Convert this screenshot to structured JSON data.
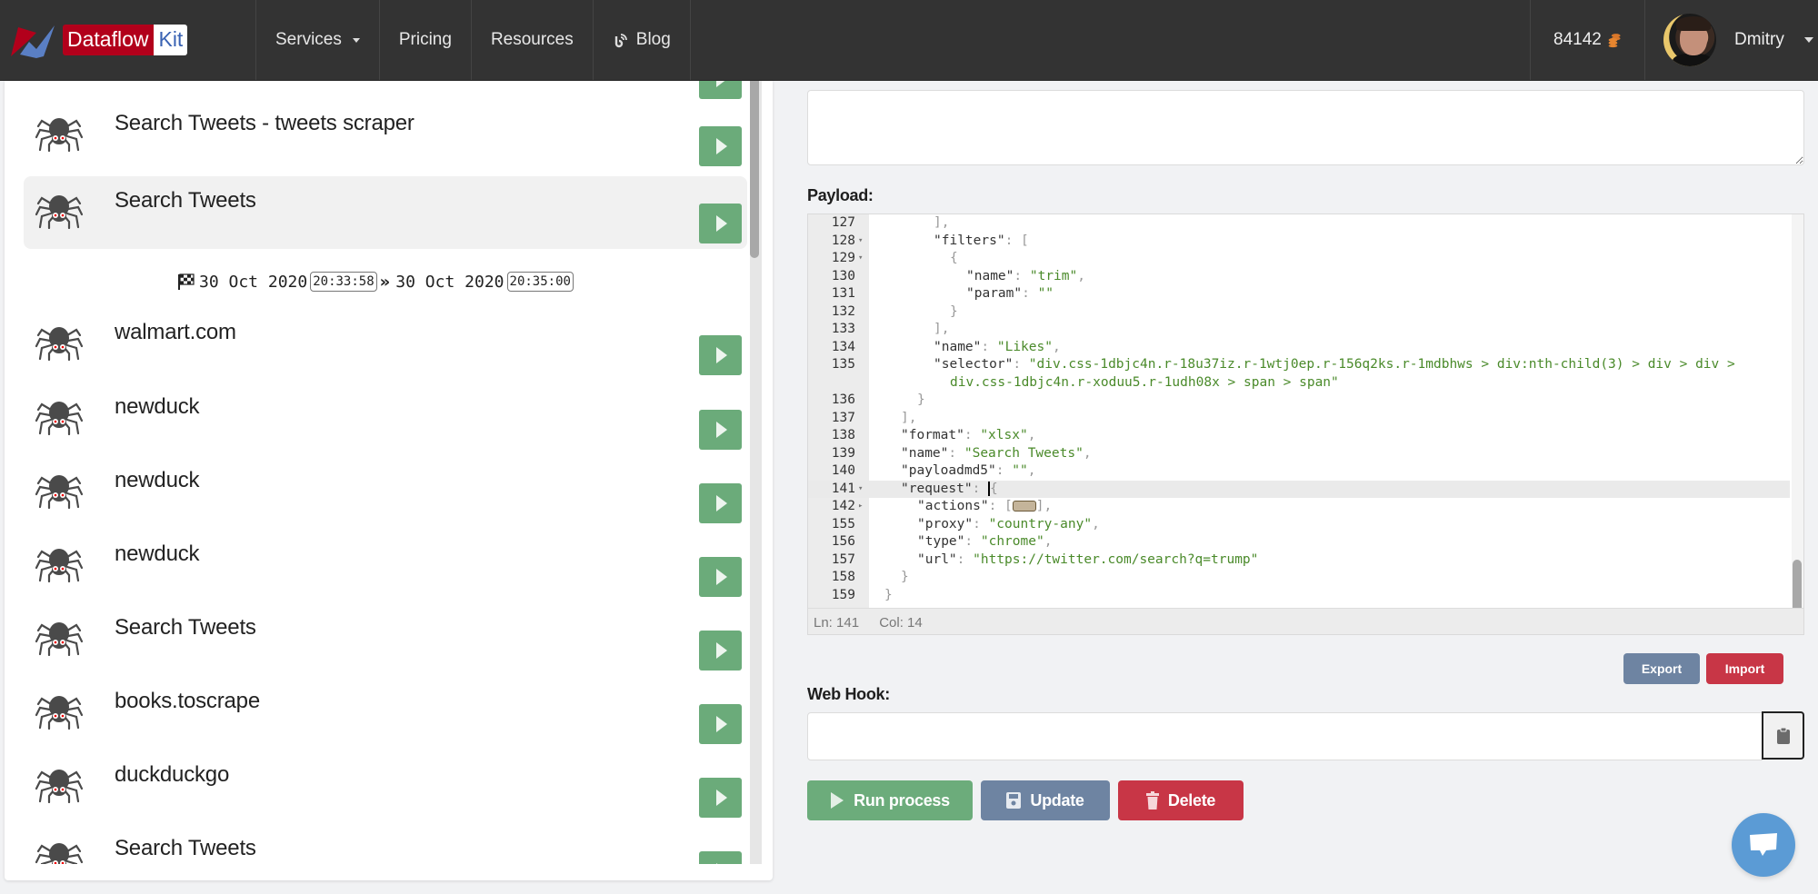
{
  "navbar": {
    "brand_part1": "Dataflow",
    "brand_part2": "Kit",
    "items": [
      {
        "label": "Services",
        "has_dropdown": true
      },
      {
        "label": "Pricing"
      },
      {
        "label": "Resources"
      },
      {
        "label": "Blog",
        "icon": "blog-rss-icon"
      }
    ],
    "credits": "84142",
    "credits_icon": "coins-icon",
    "user_name": "Dmitry"
  },
  "tasks": {
    "items": [
      {
        "title": "Search Tweets - tweets scraper",
        "active": false
      },
      {
        "title": "Search Tweets",
        "active": true
      },
      {
        "title": "walmart.com",
        "active": false
      },
      {
        "title": "newduck",
        "active": false
      },
      {
        "title": "newduck",
        "active": false
      },
      {
        "title": "newduck",
        "active": false
      },
      {
        "title": "Search Tweets",
        "active": false
      },
      {
        "title": "books.toscrape",
        "active": false
      },
      {
        "title": "duckduckgo",
        "active": false
      },
      {
        "title": "Search Tweets",
        "active": false
      }
    ],
    "active_run": {
      "start_date": "30 Oct 2020",
      "start_time": "20:33:58",
      "end_date": "30 Oct 2020",
      "end_time": "20:35:00"
    }
  },
  "form": {
    "payload_label": "Payload:",
    "webhook_label": "Web Hook:",
    "webhook_value": "",
    "editor": {
      "lines": [
        {
          "n": "127",
          "fold": "",
          "indent": 3,
          "tokens": [
            [
              "p",
              "],"
            ]
          ]
        },
        {
          "n": "128",
          "fold": "open",
          "indent": 3,
          "tokens": [
            [
              "k",
              "\"filters\""
            ],
            [
              "p",
              ": ["
            ]
          ]
        },
        {
          "n": "129",
          "fold": "open",
          "indent": 4,
          "tokens": [
            [
              "p",
              "{"
            ]
          ]
        },
        {
          "n": "130",
          "fold": "",
          "indent": 5,
          "tokens": [
            [
              "k",
              "\"name\""
            ],
            [
              "p",
              ": "
            ],
            [
              "s",
              "\"trim\""
            ],
            [
              "p",
              ","
            ]
          ]
        },
        {
          "n": "131",
          "fold": "",
          "indent": 5,
          "tokens": [
            [
              "k",
              "\"param\""
            ],
            [
              "p",
              ": "
            ],
            [
              "s",
              "\"\""
            ]
          ]
        },
        {
          "n": "132",
          "fold": "",
          "indent": 4,
          "tokens": [
            [
              "p",
              "}"
            ]
          ]
        },
        {
          "n": "133",
          "fold": "",
          "indent": 3,
          "tokens": [
            [
              "p",
              "],"
            ]
          ]
        },
        {
          "n": "134",
          "fold": "",
          "indent": 3,
          "tokens": [
            [
              "k",
              "\"name\""
            ],
            [
              "p",
              ": "
            ],
            [
              "s",
              "\"Likes\""
            ],
            [
              "p",
              ","
            ]
          ]
        },
        {
          "n": "135",
          "fold": "",
          "indent": 3,
          "tokens": [
            [
              "k",
              "\"selector\""
            ],
            [
              "p",
              ": "
            ],
            [
              "s",
              "\"div.css-1dbjc4n.r-18u37iz.r-1wtj0ep.r-156q2ks.r-1mdbhws > div:nth-child(3) > div > div >"
            ]
          ]
        },
        {
          "n": "",
          "fold": "",
          "indent": 4,
          "tokens": [
            [
              "s",
              "div.css-1dbjc4n.r-xoduu5.r-1udh08x > span > span\""
            ]
          ]
        },
        {
          "n": "136",
          "fold": "",
          "indent": 2,
          "tokens": [
            [
              "p",
              "}"
            ]
          ]
        },
        {
          "n": "137",
          "fold": "",
          "indent": 1,
          "tokens": [
            [
              "p",
              "],"
            ]
          ]
        },
        {
          "n": "138",
          "fold": "",
          "indent": 1,
          "tokens": [
            [
              "k",
              "\"format\""
            ],
            [
              "p",
              ": "
            ],
            [
              "s",
              "\"xlsx\""
            ],
            [
              "p",
              ","
            ]
          ]
        },
        {
          "n": "139",
          "fold": "",
          "indent": 1,
          "tokens": [
            [
              "k",
              "\"name\""
            ],
            [
              "p",
              ": "
            ],
            [
              "s",
              "\"Search Tweets\""
            ],
            [
              "p",
              ","
            ]
          ]
        },
        {
          "n": "140",
          "fold": "",
          "indent": 1,
          "tokens": [
            [
              "k",
              "\"payloadmd5\""
            ],
            [
              "p",
              ": "
            ],
            [
              "s",
              "\"\""
            ],
            [
              "p",
              ","
            ]
          ]
        },
        {
          "n": "141",
          "fold": "open",
          "indent": 1,
          "highlight": true,
          "tokens": [
            [
              "k",
              "\"request\""
            ],
            [
              "p",
              ": "
            ],
            [
              "cursor",
              ""
            ],
            [
              "p",
              "{"
            ]
          ]
        },
        {
          "n": "142",
          "fold": "closed",
          "indent": 2,
          "tokens": [
            [
              "k",
              "\"actions\""
            ],
            [
              "p",
              ": ["
            ],
            [
              "widget",
              ""
            ],
            [
              "p",
              "],"
            ]
          ]
        },
        {
          "n": "155",
          "fold": "",
          "indent": 2,
          "tokens": [
            [
              "k",
              "\"proxy\""
            ],
            [
              "p",
              ": "
            ],
            [
              "s",
              "\"country-any\""
            ],
            [
              "p",
              ","
            ]
          ]
        },
        {
          "n": "156",
          "fold": "",
          "indent": 2,
          "tokens": [
            [
              "k",
              "\"type\""
            ],
            [
              "p",
              ": "
            ],
            [
              "s",
              "\"chrome\""
            ],
            [
              "p",
              ","
            ]
          ]
        },
        {
          "n": "157",
          "fold": "",
          "indent": 2,
          "tokens": [
            [
              "k",
              "\"url\""
            ],
            [
              "p",
              ": "
            ],
            [
              "s",
              "\"https://twitter.com/search?q=trump\""
            ]
          ]
        },
        {
          "n": "158",
          "fold": "",
          "indent": 1,
          "tokens": [
            [
              "p",
              "}"
            ]
          ]
        },
        {
          "n": "159",
          "fold": "",
          "indent": 0,
          "tokens": [
            [
              "p",
              "}"
            ]
          ]
        }
      ],
      "status_ln": "Ln: 141",
      "status_col": "Col: 14"
    },
    "buttons": {
      "export": "Export",
      "import": "Import",
      "run": "Run process",
      "update": "Update",
      "delete": "Delete"
    }
  },
  "colors": {
    "success": "#6cac7b",
    "secondary": "#6e84a2",
    "danger": "#c83646",
    "navbar": "#333333",
    "chat": "#5b9bd5"
  }
}
